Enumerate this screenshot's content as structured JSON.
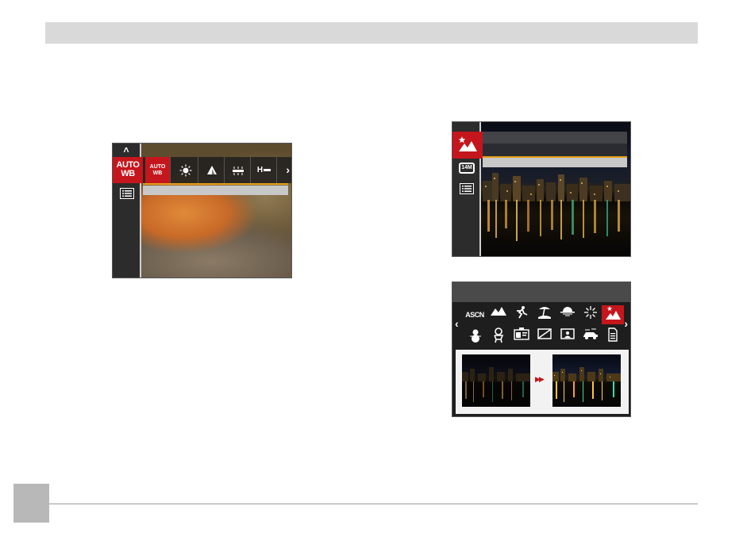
{
  "screen_wb": {
    "selected_label_line1": "AUTO",
    "selected_label_line2": "WB",
    "items": [
      {
        "icon": "auto-wb-icon",
        "line1": "AUTO",
        "line2": "WB"
      },
      {
        "icon": "daylight-icon"
      },
      {
        "icon": "cloudy-icon"
      },
      {
        "icon": "fluorescent-icon"
      },
      {
        "icon": "fluorescent-h-icon",
        "label": "H"
      }
    ]
  },
  "screen_scene_grid": {
    "row1": [
      {
        "icon": "ascn-icon",
        "label": "ASCN"
      },
      {
        "icon": "landscape-icon"
      },
      {
        "icon": "sport-icon"
      },
      {
        "icon": "beach-icon"
      },
      {
        "icon": "sunset-icon"
      },
      {
        "icon": "fireworks-icon"
      },
      {
        "icon": "night-landscape-icon"
      }
    ],
    "row2": [
      {
        "icon": "snow-icon"
      },
      {
        "icon": "children-icon"
      },
      {
        "icon": "id-icon"
      },
      {
        "icon": "frame-icon"
      },
      {
        "icon": "portrait-icon"
      },
      {
        "icon": "party-icon"
      },
      {
        "icon": "text-icon"
      }
    ]
  },
  "colors": {
    "accent_red": "#c4161c",
    "underline_orange": "#e4a11b"
  }
}
